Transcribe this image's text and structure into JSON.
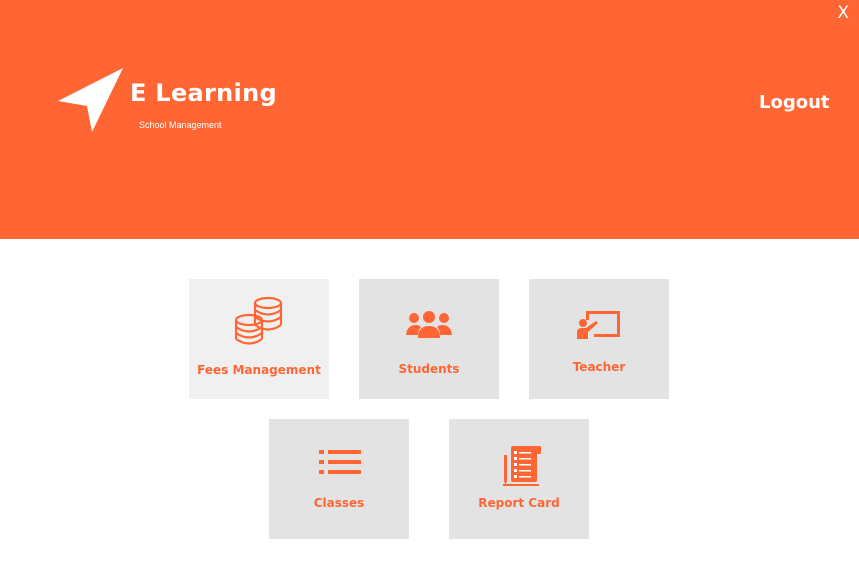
{
  "window": {
    "close_label": "X"
  },
  "header": {
    "title": "E Learning",
    "subtitle": "School Management",
    "logout_label": "Logout",
    "background": "#ff6634"
  },
  "menu": {
    "accent": "#ff6634",
    "tiles": [
      {
        "label": "Fees Management",
        "icon": "coins-icon",
        "selected": true
      },
      {
        "label": "Students",
        "icon": "users-group-icon",
        "selected": false
      },
      {
        "label": "Teacher",
        "icon": "teacher-board-icon",
        "selected": false
      },
      {
        "label": "Classes",
        "icon": "list-icon",
        "selected": false
      },
      {
        "label": "Report Card",
        "icon": "report-card-icon",
        "selected": false
      }
    ]
  }
}
